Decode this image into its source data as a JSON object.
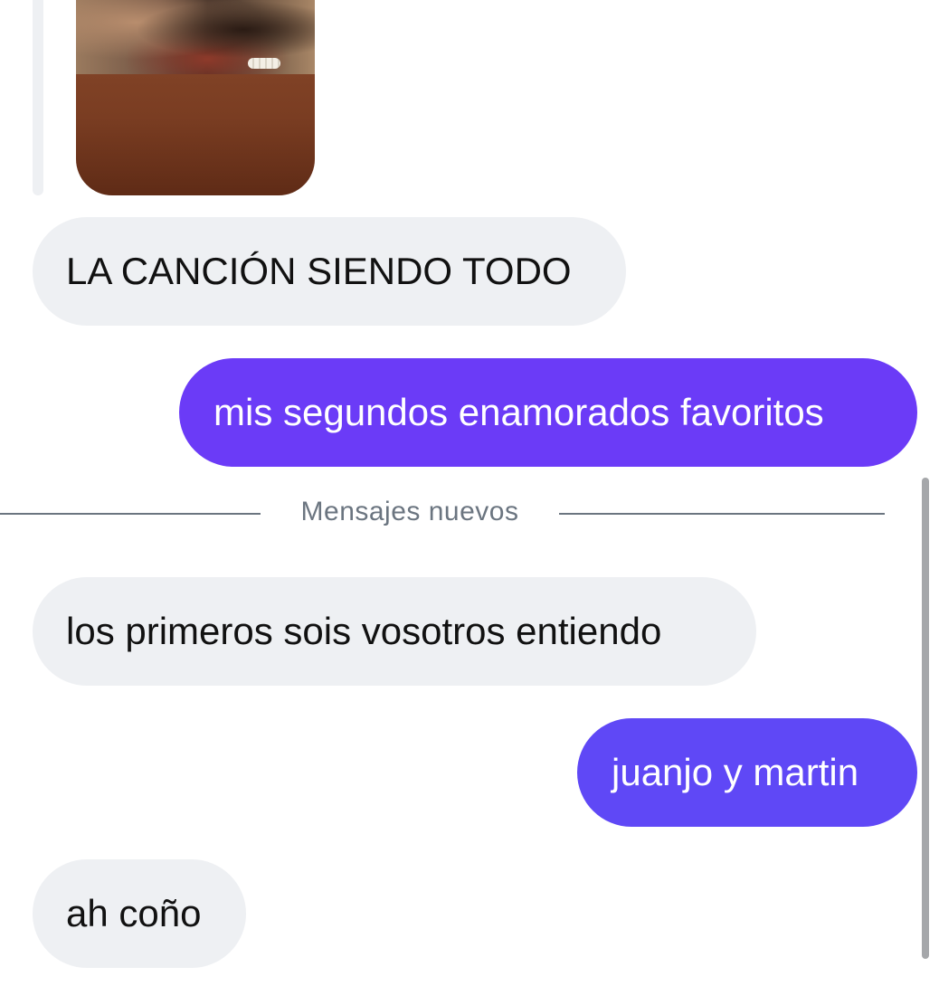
{
  "conversation": {
    "media_description_icon": "shared-photo",
    "messages": [
      {
        "direction": "incoming",
        "text": "LA CANCIÓN SIENDO TODO"
      },
      {
        "direction": "outgoing",
        "text": "mis segundos enamorados favoritos"
      },
      {
        "direction": "incoming",
        "text": "los primeros sois vosotros entiendo"
      },
      {
        "direction": "outgoing",
        "text": "juanjo y martin"
      },
      {
        "direction": "incoming",
        "text": "ah coño"
      }
    ],
    "new_messages_divider": "Mensajes nuevos"
  },
  "colors": {
    "incoming_bubble": "#eef0f3",
    "outgoing_bubble_top": "#6d3cf5",
    "outgoing_bubble_bottom": "#5e4bf5",
    "divider": "#6b7580"
  }
}
